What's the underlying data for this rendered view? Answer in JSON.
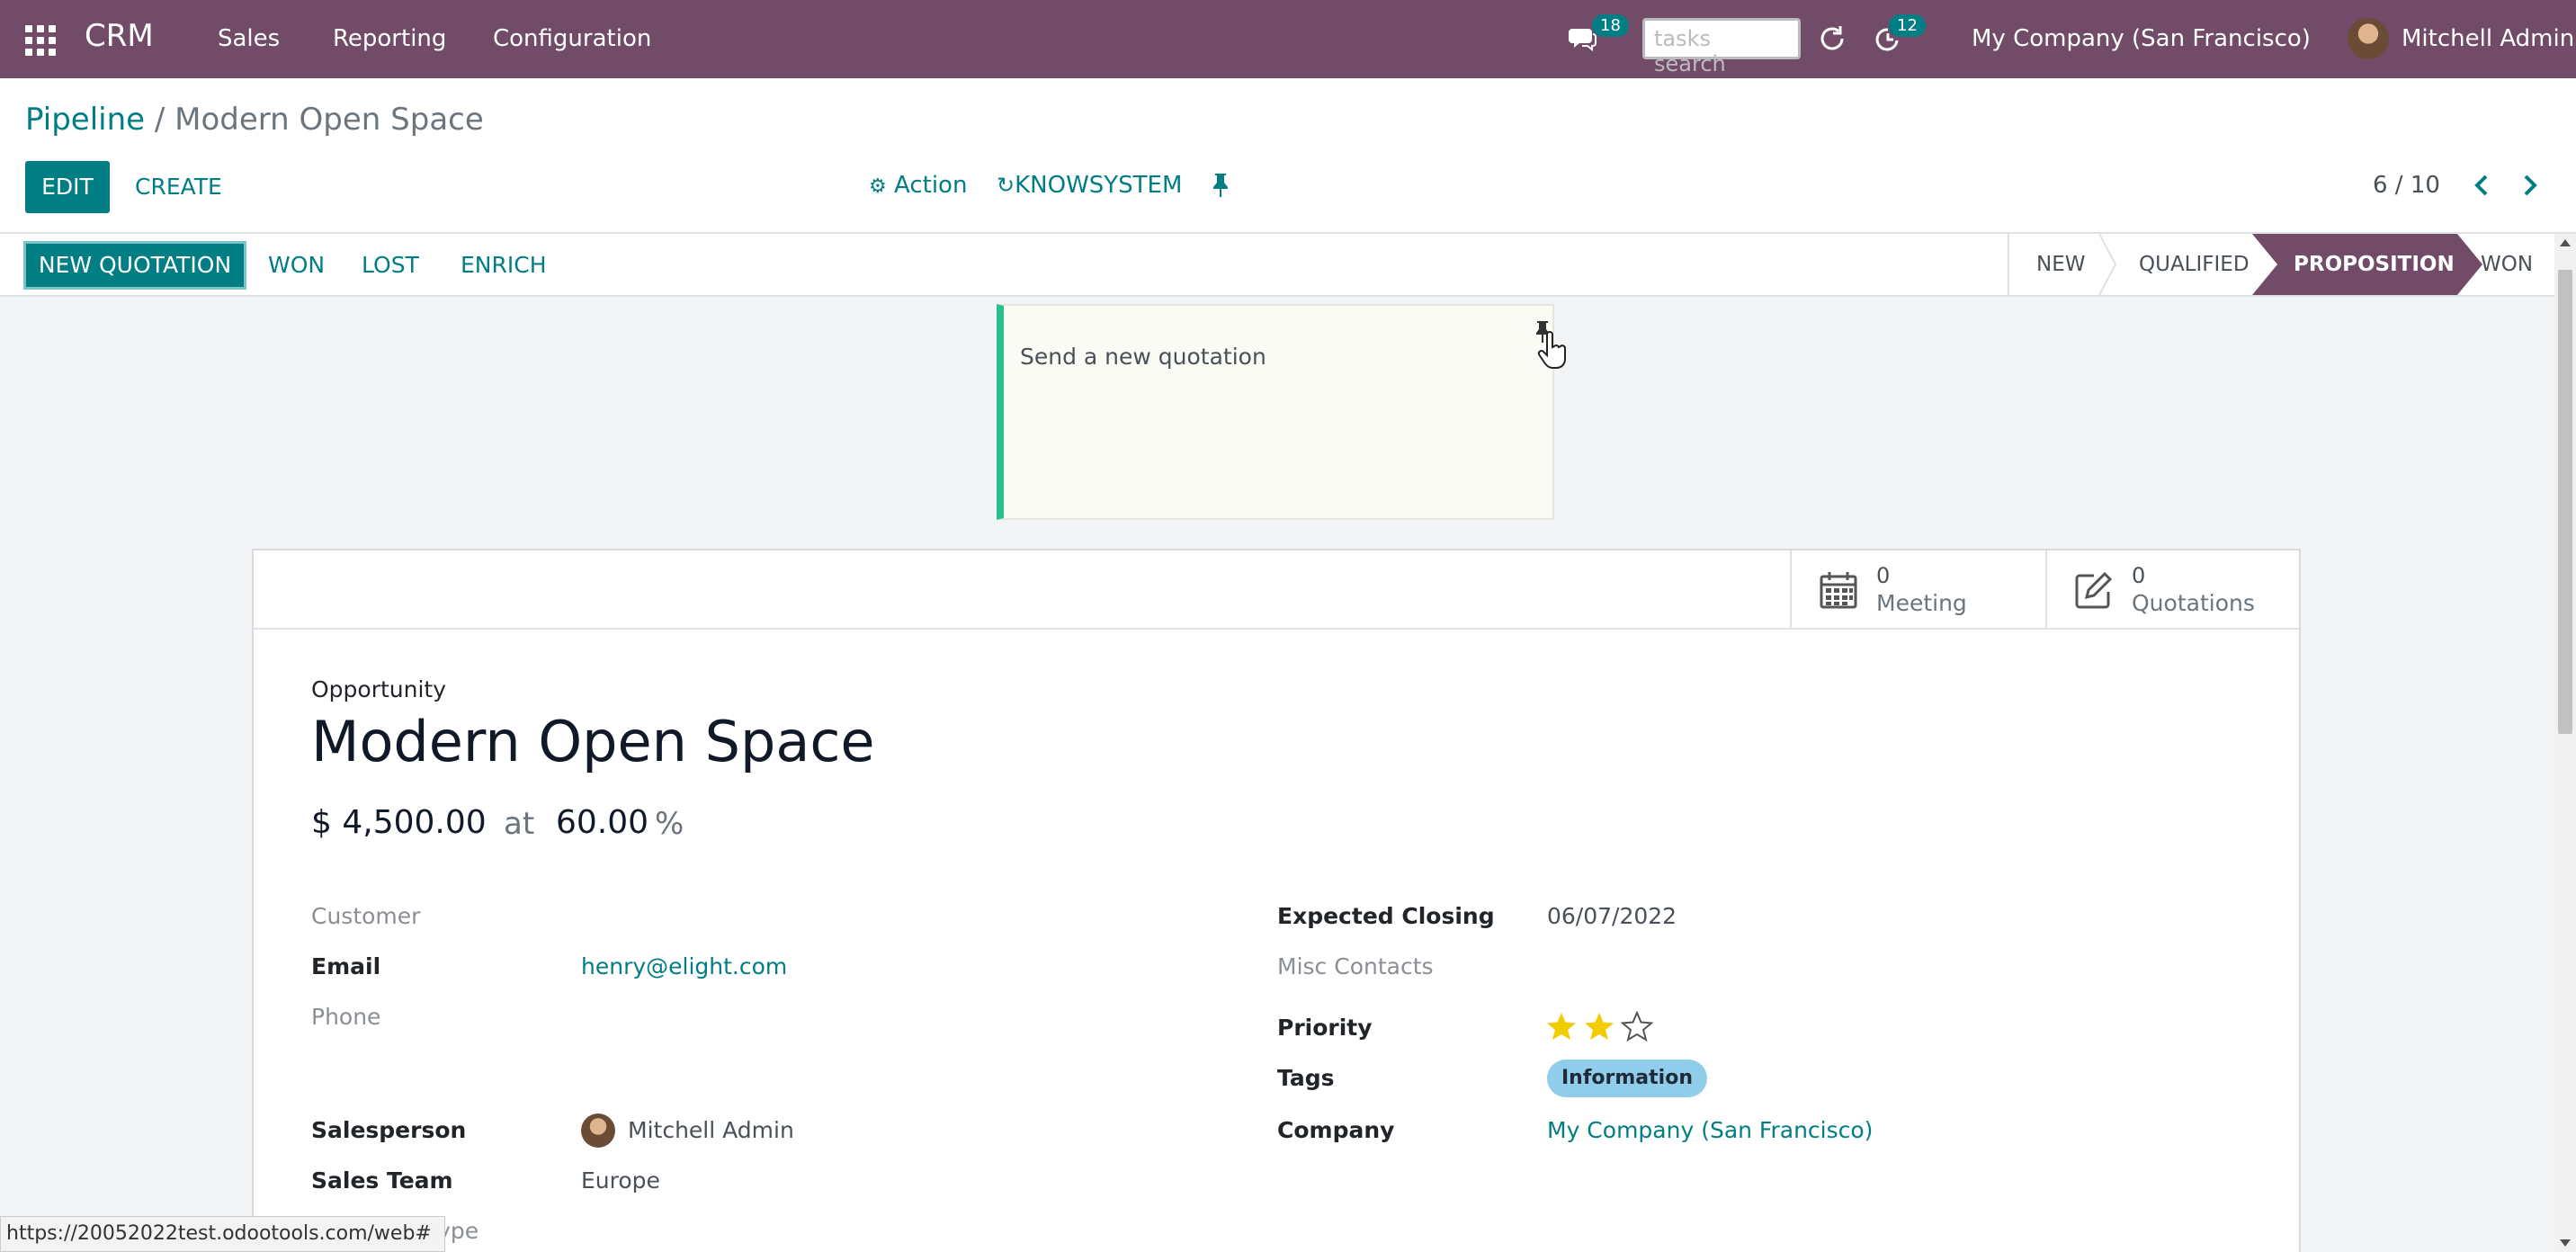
{
  "nav": {
    "app_name": "CRM",
    "menu": [
      "Sales",
      "Reporting",
      "Configuration"
    ],
    "chat_count": "18",
    "search_placeholder": "tasks search",
    "activity_count": "12",
    "company": "My Company (San Francisco)",
    "user": "Mitchell Admin"
  },
  "breadcrumb": {
    "parent": "Pipeline",
    "separator": "/",
    "current": "Modern Open Space"
  },
  "toolbar": {
    "edit": "EDIT",
    "create": "CREATE",
    "action": "Action",
    "knowsystem": "KNOWSYSTEM",
    "pager": "6 / 10"
  },
  "statusbar": {
    "buttons": [
      "NEW QUOTATION",
      "WON",
      "LOST",
      "ENRICH"
    ],
    "stages": [
      "NEW",
      "QUALIFIED",
      "PROPOSITION",
      "WON"
    ],
    "active_stage": "PROPOSITION"
  },
  "note": {
    "text": "Send a new quotation"
  },
  "smart_buttons": [
    {
      "count": "0",
      "label": "Meeting",
      "icon": "calendar-icon"
    },
    {
      "count": "0",
      "label": "Quotations",
      "icon": "pencil-square-icon"
    }
  ],
  "record": {
    "type_label": "Opportunity",
    "title": "Modern Open Space",
    "revenue": "$ 4,500.00",
    "at": "at",
    "probability": "60.00",
    "percent": "%"
  },
  "fields_left": {
    "customer": "Customer",
    "email_label": "Email",
    "email": "henry@elight.com",
    "phone": "Phone",
    "salesperson_label": "Salesperson",
    "salesperson": "Mitchell Admin",
    "sales_team_label": "Sales Team",
    "sales_team": "Europe",
    "partial_label": "y Type"
  },
  "fields_right": {
    "expected_closing_label": "Expected Closing",
    "expected_closing": "06/07/2022",
    "misc_contacts": "Misc Contacts",
    "priority_label": "Priority",
    "priority_stars": 2,
    "priority_max": 3,
    "tags_label": "Tags",
    "tag": "Information",
    "company_label": "Company",
    "company": "My Company (San Francisco)"
  },
  "status_url": "https://20052022test.odootools.com/web#",
  "colors": {
    "brand": "#714b67",
    "accent": "#017e84",
    "star": "#f3cc00",
    "note_border": "#28c08e",
    "tag": "#8fcdea"
  }
}
